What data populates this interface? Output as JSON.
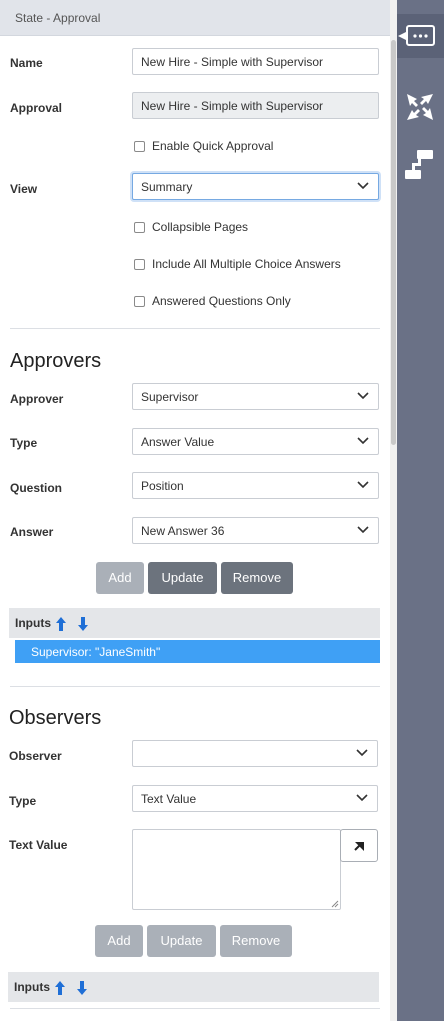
{
  "header": {
    "title": "State - Approval"
  },
  "form": {
    "name_label": "Name",
    "name_value": "New Hire - Simple with Supervisor",
    "approval_label": "Approval",
    "approval_value": "New Hire - Simple with Supervisor",
    "enable_quick_approval": "Enable Quick Approval",
    "view_label": "View",
    "view_value": "Summary",
    "collapsible_pages": "Collapsible Pages",
    "include_all_mc": "Include All Multiple Choice Answers",
    "answered_only": "Answered Questions Only"
  },
  "approvers": {
    "title": "Approvers",
    "approver_label": "Approver",
    "approver_value": "Supervisor",
    "type_label": "Type",
    "type_value": "Answer Value",
    "question_label": "Question",
    "question_value": "Position",
    "answer_label": "Answer",
    "answer_value": "New Answer 36",
    "add": "Add",
    "update": "Update",
    "remove": "Remove",
    "inputs_label": "Inputs",
    "inputs_items": [
      "Supervisor: \"JaneSmith\""
    ]
  },
  "observers": {
    "title": "Observers",
    "observer_label": "Observer",
    "observer_value": "",
    "type_label": "Type",
    "type_value": "Text Value",
    "text_value_label": "Text Value",
    "text_value": "",
    "add": "Add",
    "update": "Update",
    "remove": "Remove",
    "inputs_label": "Inputs"
  },
  "rail": {
    "icons": [
      "comment-icon",
      "collapse-arrows-icon",
      "flow-steps-icon"
    ]
  },
  "colors": {
    "rail": "#6a7186",
    "selection": "#3fa0f5",
    "arrow_blue": "#1f6fd6"
  }
}
